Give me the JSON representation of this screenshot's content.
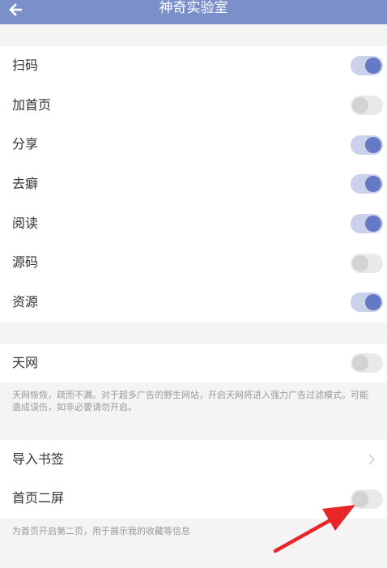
{
  "header": {
    "title": "神奇实验室",
    "back_icon": "arrow-left-icon"
  },
  "group1": {
    "items": [
      {
        "label": "扫码",
        "on": true
      },
      {
        "label": "加首页",
        "on": false
      },
      {
        "label": "分享",
        "on": true
      },
      {
        "label": "去癖",
        "on": true
      },
      {
        "label": "阅读",
        "on": true
      },
      {
        "label": "源码",
        "on": false
      },
      {
        "label": "资源",
        "on": true
      }
    ]
  },
  "tianwang": {
    "label": "天网",
    "on": false,
    "description": "天网恢恢，疏而不漏。对于超多广告的野生网站，开启天网将进入强力广告过滤模式。可能造成误伤，如非必要请勿开启。"
  },
  "group3": {
    "import_bookmarks_label": "导入书签",
    "second_screen_label": "首页二屏",
    "second_screen_on": false,
    "second_screen_description": "为首页开启第二页，用于展示我的收藏等信息"
  },
  "colors": {
    "header": "#7b8fcb",
    "toggle_on_track": "#c9d1eb",
    "toggle_on_knob": "#6679c4",
    "toggle_off_track": "#e9e9e9",
    "toggle_off_knob": "#d3d3d3",
    "annotation_arrow": "#e8262a"
  }
}
